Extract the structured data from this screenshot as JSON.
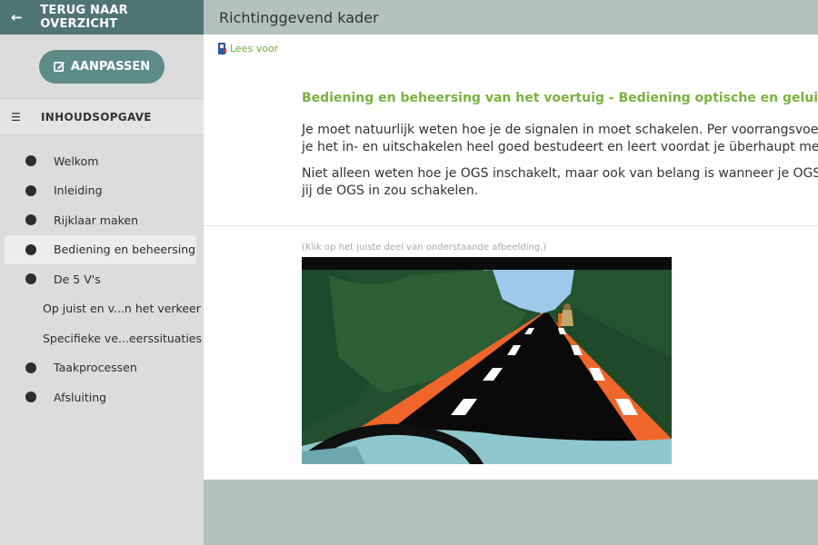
{
  "sidebar": {
    "back_label": "TERUG NAAR OVERZICHT",
    "edit_label": "AANPASSEN",
    "toc_label": "INHOUDSOPGAVE",
    "items": [
      {
        "label": "Welkom"
      },
      {
        "label": "Inleiding"
      },
      {
        "label": "Rijklaar maken"
      },
      {
        "label": "Bediening en beheersing",
        "active": true
      },
      {
        "label": "De 5 V's"
      },
      {
        "label": "Op juist en v...n het verkeer"
      },
      {
        "label": "Specifieke ve...eerssituaties"
      },
      {
        "label": "Taakprocessen"
      },
      {
        "label": "Afsluiting"
      }
    ]
  },
  "header": {
    "title": "Richtinggevend kader"
  },
  "main": {
    "read_aloud": "Lees voor",
    "heading": "Bediening en beheersing van het voertuig - Bediening optische en geluidssignalen",
    "paragraph1": [
      "Je moet natuurlijk weten hoe je de signalen in moet schakelen. Per voorrangsvoertuig verschilt dit, zorg dat",
      "je het in- en uitschakelen heel goed bestudeert en leert voordat je überhaupt met de auto gaat rijden."
    ],
    "paragraph2": [
      "Niet alleen weten hoe je OGS inschakelt, maar ook van belang is wanneer je OGS inschakelt. Wanneer zou",
      "jij de OGS in zou schakelen."
    ],
    "hint": "(Klik op het juiste deel van onderstaande afbeelding.)"
  },
  "colors": {
    "accent_dark": "#4f7572",
    "accent_button": "#5d8b87",
    "heading_green": "#7ab240",
    "road_orange": "#f0652a",
    "foliage_dark": "#1f4e2d",
    "foliage": "#2c5b33",
    "sky": "#9ec9eb"
  },
  "icons": {
    "back": "arrow-left-icon",
    "edit": "edit-square-icon",
    "toc": "list-icon",
    "read_aloud": "speaker-icon"
  }
}
